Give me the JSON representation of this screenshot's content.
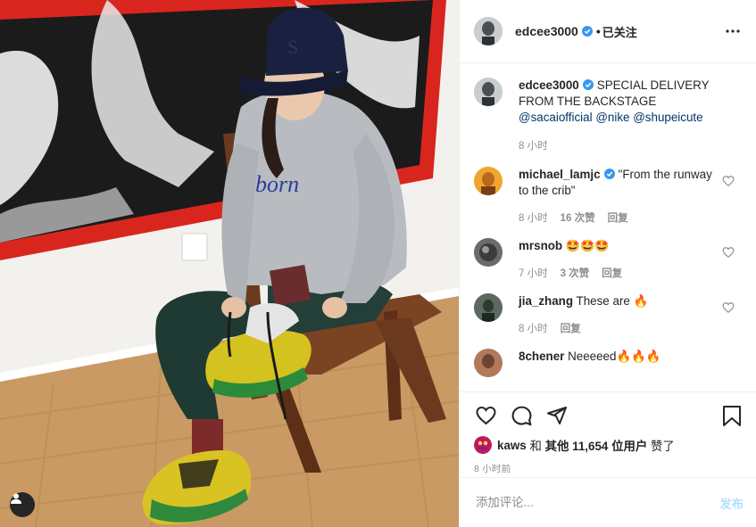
{
  "colors": {
    "text": "#262626",
    "secondary": "#8e8e8e",
    "link": "#00376b",
    "verified": "#3897f0",
    "post_disabled": "#b2dffc",
    "border": "#efefef"
  },
  "photo": {
    "description_icon": "user-tag-icon"
  },
  "header": {
    "username": "edcee3000",
    "separator": "•",
    "follow_state": "已关注",
    "more_icon": "more-options-icon"
  },
  "caption": {
    "username": "edcee3000",
    "text": "SPECIAL DELIVERY FROM THE BACKSTAGE",
    "mention_1": "@sacaiofficial",
    "mention_2": "@nike",
    "mention_3": "@shupeicute",
    "time": "8 小时"
  },
  "comments": [
    {
      "username": "michael_lamjc",
      "verified": true,
      "text": "\"From the runway to the crib\"",
      "time": "8 小时",
      "likes": "16 次赞",
      "reply": "回复"
    },
    {
      "username": "mrsnob",
      "verified": false,
      "text": "🤩🤩🤩",
      "time": "7 小时",
      "likes": "3 次赞",
      "reply": "回复"
    },
    {
      "username": "jia_zhang",
      "verified": false,
      "text": "These are 🔥",
      "time": "8 小时",
      "likes": "",
      "reply": "回复"
    },
    {
      "username": "8chener",
      "verified": false,
      "text": "Neeeeed🔥🔥🔥",
      "time": "",
      "likes": "",
      "reply": ""
    }
  ],
  "actions": {
    "like_icon": "heart-icon",
    "comment_icon": "comment-icon",
    "share_icon": "share-icon",
    "save_icon": "bookmark-icon"
  },
  "likes": {
    "first_liker": "kaws",
    "connector": "和",
    "others": "其他 11,654 位用户",
    "suffix": "赞了"
  },
  "timestamp": "8 小时前",
  "add_comment": {
    "placeholder": "添加评论...",
    "post_label": "发布"
  }
}
